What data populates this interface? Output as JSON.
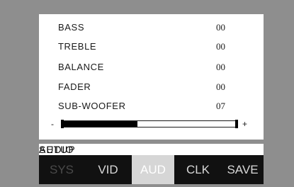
{
  "menu": {
    "items": [
      {
        "label": "BASS",
        "value": "00"
      },
      {
        "label": "TREBLE",
        "value": "00"
      },
      {
        "label": "BALANCE",
        "value": "00"
      },
      {
        "label": "FADER",
        "value": "00"
      },
      {
        "label": "SUB-WOOFER",
        "value": "07"
      }
    ],
    "slider": {
      "minus_label": "-",
      "plus_label": "+",
      "level_fraction": 0.43
    }
  },
  "title": {
    "word1": "AUDIO",
    "word2": "SETUP"
  },
  "tabs": [
    {
      "label": "SYS",
      "state": "dim"
    },
    {
      "label": "VID",
      "state": "normal"
    },
    {
      "label": "AUD",
      "state": "active"
    },
    {
      "label": "CLK",
      "state": "normal"
    },
    {
      "label": "SAVE",
      "state": "normal"
    }
  ],
  "colors": {
    "background": "#8e8e8e",
    "panel": "#ffffff",
    "tab_bar": "#0c0c0c",
    "tab_active": "#d6d6d6",
    "slider_fill": "#000000"
  }
}
